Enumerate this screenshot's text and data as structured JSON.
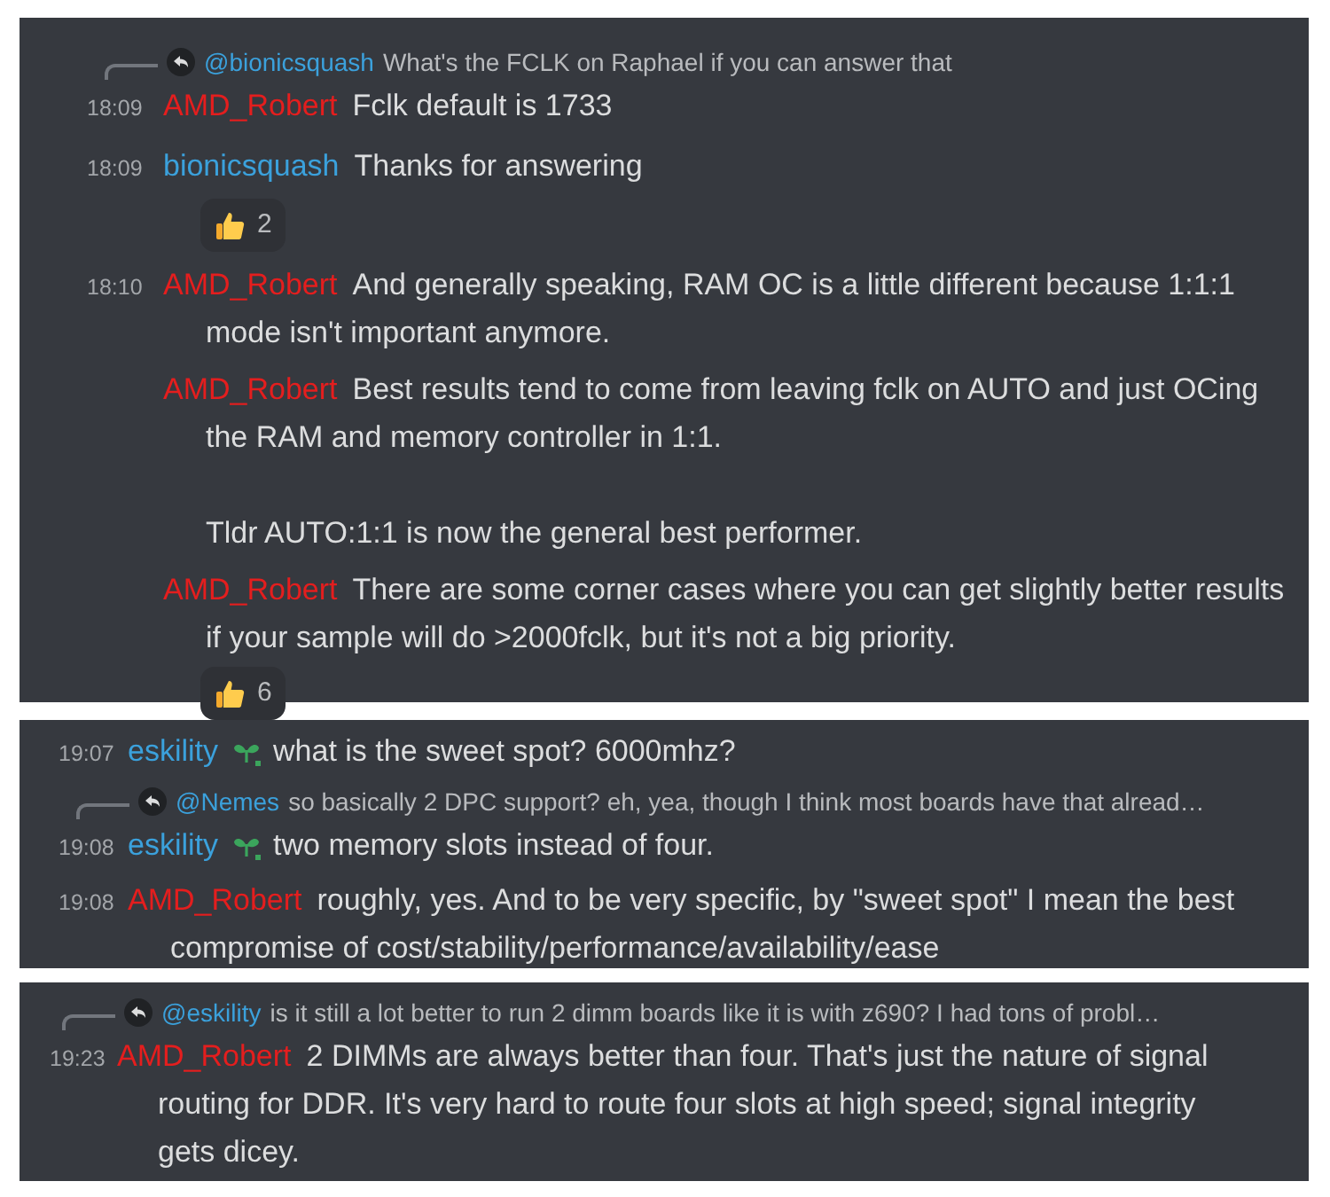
{
  "panels": [
    {
      "messages": [
        {
          "kind": "message",
          "reply": {
            "mention": "@bionicsquash",
            "text": "What's the FCLK on Raphael if you can answer that"
          },
          "time": "18:09",
          "author": "AMD_Robert",
          "color": "#e41e1e",
          "text": "Fclk default is 1733"
        },
        {
          "kind": "message",
          "time": "18:09",
          "author": "bionicsquash",
          "color": "#3ba1dc",
          "text": "Thanks for answering",
          "reaction": {
            "count": "2"
          }
        },
        {
          "kind": "message",
          "time": "18:10",
          "author": "AMD_Robert",
          "color": "#e41e1e",
          "text": "And generally speaking, RAM OC is a little different because 1:1:1 mode isn't important anymore."
        },
        {
          "kind": "continuation",
          "author": "AMD_Robert",
          "color": "#e41e1e",
          "text": "Best results tend to come from leaving fclk on AUTO and just OCing the RAM and memory controller in 1:1.\n\nTldr AUTO:1:1 is now the general best performer."
        },
        {
          "kind": "continuation",
          "author": "AMD_Robert",
          "color": "#e41e1e",
          "text": "There are some corner cases where you can get slightly better results if your sample will do >2000fclk, but it's not a big priority.",
          "reaction": {
            "count": "6"
          }
        }
      ]
    },
    {
      "messages": [
        {
          "kind": "message",
          "time": "19:07",
          "author": "eskility",
          "color": "#3ba1dc",
          "badge": true,
          "text": "what is the sweet spot? 6000mhz?"
        },
        {
          "kind": "message",
          "reply": {
            "mention": "@Nemes",
            "text": "so basically 2 DPC support? eh, yea, though I think most boards have that alread…"
          },
          "time": "19:08",
          "author": "eskility",
          "color": "#3ba1dc",
          "badge": true,
          "text": "two memory slots instead of four."
        },
        {
          "kind": "message",
          "time": "19:08",
          "author": "AMD_Robert",
          "color": "#e41e1e",
          "text": "roughly, yes. And to be very specific, by \"sweet spot\" I mean the best compromise of cost/stability/performance/availability/ease"
        }
      ]
    },
    {
      "messages": [
        {
          "kind": "message",
          "reply": {
            "mention": "@eskility",
            "text": "is it still a lot better to run 2 dimm boards like it is with z690? I had tons of probl…"
          },
          "time": "19:23",
          "author": "AMD_Robert",
          "color": "#e41e1e",
          "text": "2 DIMMs are always better than four. That's just the nature of signal routing for DDR. It's very hard to route four slots at high speed; signal integrity gets dicey."
        }
      ]
    }
  ]
}
